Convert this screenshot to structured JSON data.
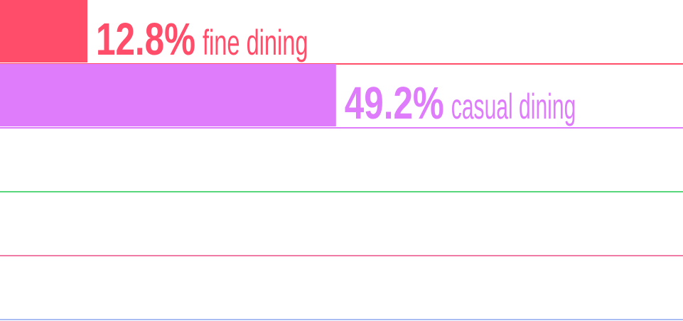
{
  "chart_data": {
    "type": "bar",
    "orientation": "horizontal",
    "unit": "%",
    "xlim": [
      0,
      100
    ],
    "grid": false,
    "legend": "none",
    "categories": [
      "fine dining",
      "casual dining",
      "",
      "",
      ""
    ],
    "values": [
      12.8,
      49.2,
      null,
      null,
      null
    ],
    "value_labels": [
      "12.8%",
      "49.2%",
      "",
      "",
      ""
    ],
    "colors": [
      "#ff4d6a",
      "#de7cfb",
      "#5ad67d",
      "#f07ca5",
      "#a9bdf2"
    ]
  }
}
